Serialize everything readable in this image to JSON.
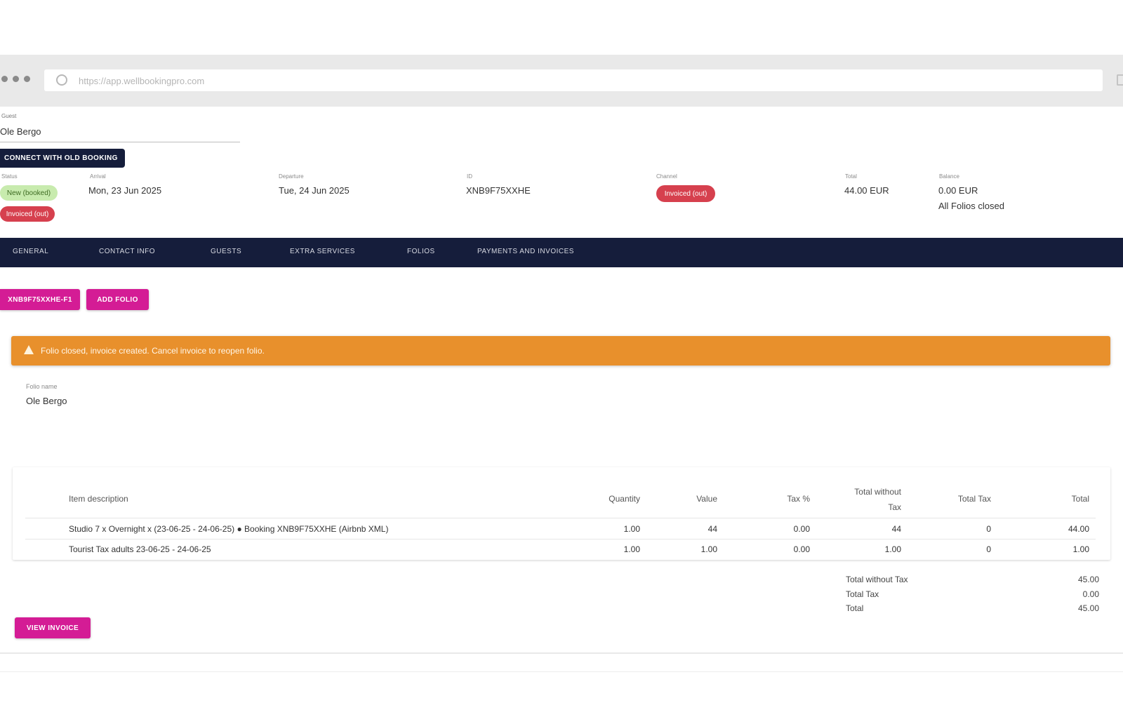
{
  "browser": {
    "url": "https://app.wellbookingpro.com"
  },
  "guest": {
    "label": "Guest",
    "name": "Ole Bergo"
  },
  "connect_button": "CONNECT WITH OLD BOOKING",
  "info": {
    "status": {
      "label": "Status",
      "badge_primary": "New (booked)",
      "badge_secondary": "Invoiced (out)"
    },
    "arrival": {
      "label": "Arrival",
      "value": "Mon, 23 Jun 2025"
    },
    "departure": {
      "label": "Departure",
      "value": "Tue, 24 Jun 2025"
    },
    "id": {
      "label": "ID",
      "value": "XNB9F75XXHE"
    },
    "channel": {
      "label": "Channel",
      "badge": "Invoiced (out)"
    },
    "total": {
      "label": "Total",
      "value": "44.00 EUR"
    },
    "balance": {
      "label": "Balance",
      "value": "0.00 EUR",
      "note": "All Folios closed"
    }
  },
  "tabs": [
    {
      "label": "GENERAL"
    },
    {
      "label": "CONTACT INFO"
    },
    {
      "label": "GUESTS"
    },
    {
      "label": "EXTRA SERVICES"
    },
    {
      "label": "FOLIOS"
    },
    {
      "label": "PAYMENTS AND INVOICES"
    }
  ],
  "actions": {
    "folio_button": "XNB9F75XXHE-F1",
    "add_folio_button": "ADD FOLIO"
  },
  "banner": {
    "message": "Folio closed, invoice created. Cancel invoice to reopen folio.",
    "color": "#e8902c"
  },
  "folio": {
    "label": "Folio name",
    "value": "Ole Bergo"
  },
  "table": {
    "headers": {
      "description": "Item description",
      "quantity": "Quantity",
      "value": "Value",
      "tax_pct": "Tax %",
      "total_without_tax_line1": "Total without",
      "total_without_tax_line2": "Tax",
      "total_tax": "Total Tax",
      "total": "Total"
    },
    "rows": [
      {
        "description": "Studio 7 x Overnight x (23-06-25 - 24-06-25) ● Booking XNB9F75XXHE (Airbnb XML)",
        "quantity": "1.00",
        "value": "44",
        "tax_pct": "0.00",
        "total_without_tax": "44",
        "total_tax": "0",
        "total": "44.00"
      },
      {
        "description": "Tourist Tax adults 23-06-25 - 24-06-25",
        "quantity": "1.00",
        "value": "1.00",
        "tax_pct": "0.00",
        "total_without_tax": "1.00",
        "total_tax": "0",
        "total": "1.00"
      }
    ]
  },
  "summary": {
    "total_without_tax_label": "Total without Tax",
    "total_without_tax_value": "45.00",
    "total_tax_label": "Total Tax",
    "total_tax_value": "0.00",
    "total_label": "Total",
    "total_value": "45.00"
  },
  "view_invoice_button": "VIEW INVOICE",
  "colors": {
    "navy": "#151d3b",
    "magenta": "#d41c95",
    "orange": "#e8902c",
    "red": "#d6404e",
    "green_badge": "#c8ebae"
  }
}
